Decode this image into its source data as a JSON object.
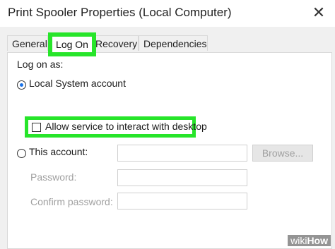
{
  "window": {
    "title": "Print Spooler Properties (Local Computer)",
    "close_glyph": "✕"
  },
  "tabs": {
    "general": "General",
    "logon": "Log On",
    "recovery": "Recovery",
    "dependencies": "Dependencies",
    "active": "logon"
  },
  "logon": {
    "section_label": "Log on as:",
    "local_system_label": "Local System account",
    "local_system_selected": true,
    "allow_interact_label": "Allow service to interact with desktop",
    "allow_interact_checked": false,
    "this_account_label": "This account:",
    "this_account_value": "",
    "browse_label": "Browse...",
    "password_label": "Password:",
    "password_value": "",
    "confirm_label": "Confirm password:",
    "confirm_value": ""
  },
  "highlight_color": "#27e52a",
  "watermark": {
    "prefix": "wiki",
    "suffix": "How"
  }
}
